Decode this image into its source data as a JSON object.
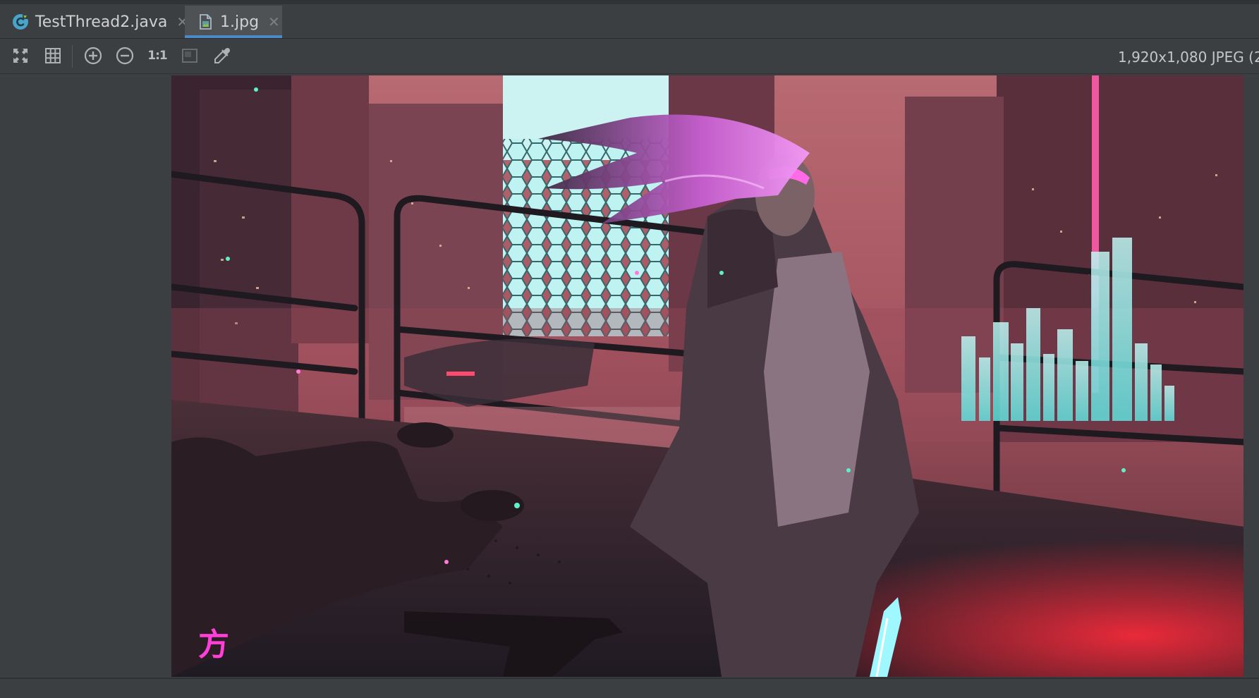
{
  "tabs": [
    {
      "label": "TestThread2.java",
      "icon": "java-class-icon",
      "active": false
    },
    {
      "label": "1.jpg",
      "icon": "image-file-icon",
      "active": true
    }
  ],
  "toolbar": {
    "fit_icon": "fit-to-window-icon",
    "grid_icon": "grid-icon",
    "zoom_in_icon": "zoom-in-icon",
    "zoom_out_icon": "zoom-out-icon",
    "actual_size_label": "1:1",
    "background_icon": "background-icon",
    "color_picker_icon": "color-picker-icon"
  },
  "image_info": "1,920x1,080 JPEG (2",
  "image": {
    "watermark_text": "方"
  },
  "colors": {
    "accent": "#4a88c7",
    "panel": "#3c3f41",
    "active_tab": "#4e5254"
  }
}
